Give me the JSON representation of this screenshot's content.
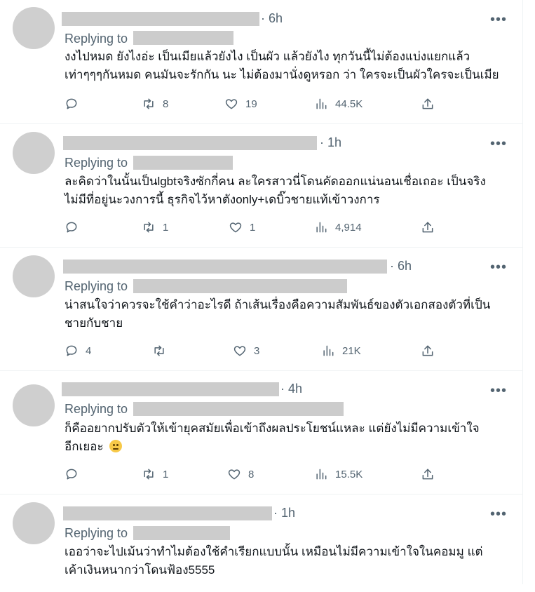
{
  "tweets": [
    {
      "time": "6h",
      "reply_label": "Replying to",
      "lines": [
        "งงไปหมด ยังไงอ่ะ เป็นเมียแล้วยังไง เป็นผัว แล้วยังไง ทุกวันนี้ไม่ต้องแบ่งแยกแล้ว",
        "เท่าๆๆๆกันหมด คนมันจะรักกัน นะ ไม่ต้องมานั่งดูหรอก ว่า ใครจะเป็นผัวใครจะเป็นเมีย"
      ],
      "replies": "",
      "retweets": "8",
      "likes": "19",
      "views": "44.5K"
    },
    {
      "time": "1h",
      "reply_label": "Replying to",
      "lines": [
        "ละคิดว่าในนั้นเป็นlgbtจริงซักกี่คน ละใครสาวนี่โดนคัดออกแน่นอนเชื่อเถอะ เป็นจริง",
        "ไม่มีที่อยู่นะวงการนี้ ธุรกิจไว้หาตังonly+เดบิ๊วชายแท้เข้าวงการ"
      ],
      "replies": "",
      "retweets": "1",
      "likes": "1",
      "views": "4,914"
    },
    {
      "time": "6h",
      "reply_label": "Replying to",
      "lines": [
        "น่าสนใจว่าควรจะใช้คำว่าอะไรดี ถ้าเส้นเรื่องคือความสัมพันธ์ของตัวเอกสองตัวที่เป็น",
        "ชายกับชาย"
      ],
      "replies": "4",
      "retweets": "",
      "likes": "3",
      "views": "21K"
    },
    {
      "time": "4h",
      "reply_label": "Replying to",
      "lines": [
        "ก็คืออยากปรับตัวให้เข้ายุคสมัยเพื่อเข้าถึงผลประโยชน์แหละ แต่ยังไม่มีความเข้าใจ",
        "อีกเยอะ"
      ],
      "emoji": "face-with-rolling-eyes-emoji",
      "replies": "",
      "retweets": "1",
      "likes": "8",
      "views": "15.5K"
    },
    {
      "time": "1h",
      "reply_label": "Replying to",
      "lines": [
        "เออว่าจะไปเม้นว่าทำไมต้องใช้คำเรียกแบบนั้น เหมือนไม่มีความเข้าใจในคอมมู แต่",
        "เค้าเงินหนากว่าโดนฟ้อง5555"
      ],
      "replies": "",
      "retweets": "",
      "likes": "",
      "views": ""
    }
  ],
  "more_label": "•••",
  "icons": {
    "reply": "reply-icon",
    "retweet": "retweet-icon",
    "like": "heart-icon",
    "views": "views-chart-icon",
    "share": "share-icon"
  },
  "colors": {
    "text": "#0f1419",
    "muted": "#536471",
    "redaction": "#cccccc",
    "divider": "#eff3f4"
  }
}
